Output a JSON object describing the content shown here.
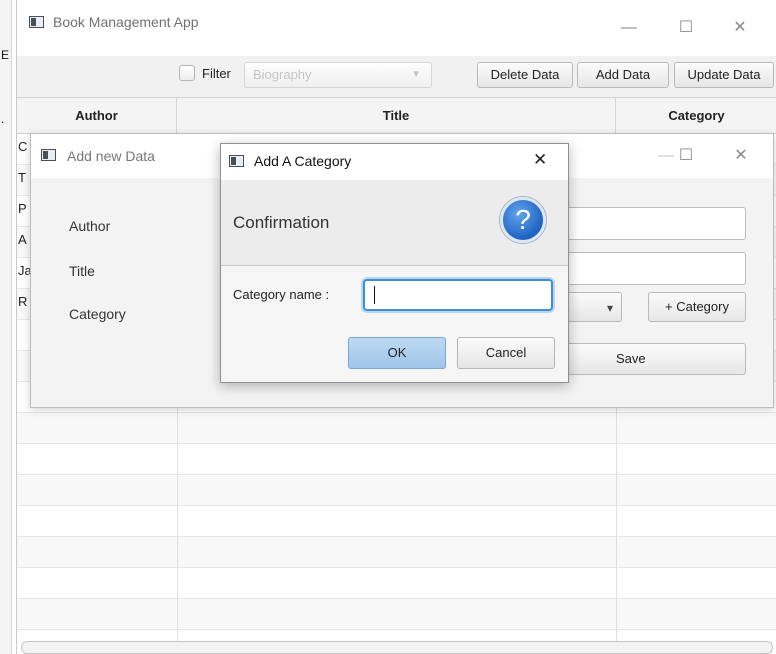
{
  "background_window": {
    "left_edge_chars": [
      "E",
      "."
    ]
  },
  "main_window": {
    "title": "Book Management App",
    "controls": {
      "minimize": "—",
      "maximize": "☐",
      "close": "✕"
    },
    "toolbar": {
      "filter_label": "Filter",
      "filter_checked": false,
      "filter_combo_value": "Biography",
      "delete_label": "Delete Data",
      "add_label": "Add Data",
      "update_label": "Update Data"
    },
    "table": {
      "columns": [
        "Author",
        "Title",
        "Category"
      ],
      "row_first_letters": [
        "C",
        "T",
        "P",
        "A",
        "Ja",
        "R"
      ]
    }
  },
  "add_window": {
    "title": "Add new Data",
    "controls": {
      "minimize": "—",
      "maximize": "☐",
      "close": "✕"
    },
    "labels": {
      "author": "Author",
      "title": "Title",
      "category": "Category"
    },
    "category_combo_arrow": "▾",
    "add_category_label": "+ Category",
    "save_label": "Save"
  },
  "category_dialog": {
    "title": "Add A Category",
    "close": "✕",
    "header_text": "Confirmation",
    "icon": "question-icon",
    "icon_glyph": "?",
    "field_label": "Category name :",
    "field_value": "",
    "ok_label": "OK",
    "cancel_label": "Cancel"
  }
}
